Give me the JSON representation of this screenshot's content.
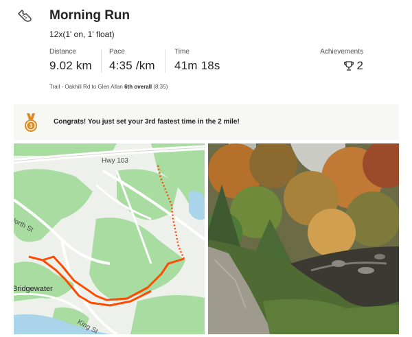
{
  "activity": {
    "icon": "running-shoe-icon",
    "title": "Morning Run",
    "description": "12x(1' on, 1' float)"
  },
  "stats": [
    {
      "label": "Distance",
      "value": "9.02 km"
    },
    {
      "label": "Pace",
      "value": "4:35 /km"
    },
    {
      "label": "Time",
      "value": "41m 18s"
    }
  ],
  "achievements": {
    "label": "Achievements",
    "count": "2",
    "icon": "trophy-icon"
  },
  "segment": {
    "name": "Trail - Oakhill Rd to Glen Allan",
    "rank": "6th overall",
    "time": "(8:35)"
  },
  "banner": {
    "icon": "bronze-medal-icon",
    "text": "Congrats! You just set your 3rd fastest time in the 2 mile!"
  },
  "map": {
    "labels": {
      "highway": "Hwy 103",
      "north_st": "North St",
      "town": "Bridgewater",
      "king_st": "King St"
    },
    "colors": {
      "route": "#fc4c02",
      "park": "#a8dca0",
      "water": "#a9d4ea"
    }
  },
  "colors": {
    "accent": "#fc4c02",
    "medal": "#e08a1e",
    "banner_bg": "#f7f7f4"
  }
}
